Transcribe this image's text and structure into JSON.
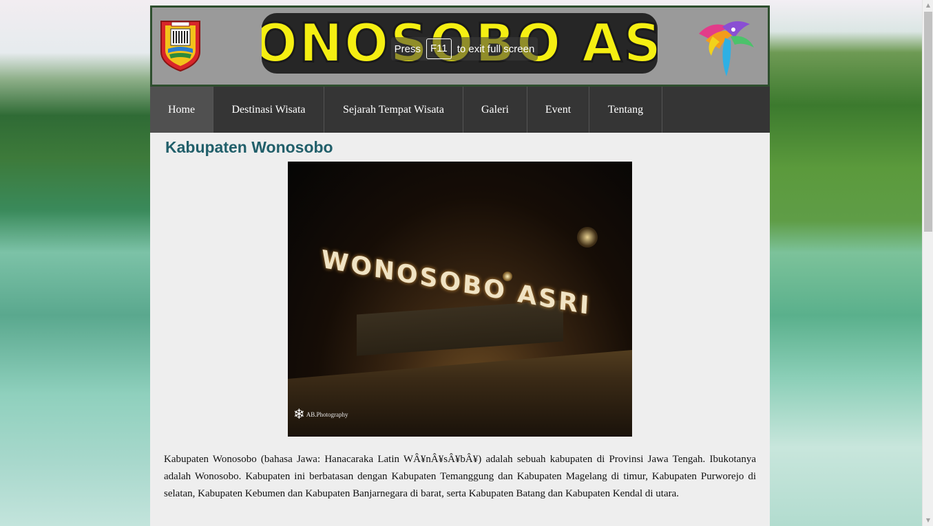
{
  "header": {
    "banner_text": "WONOSOBO ASRI",
    "fullscreen_notice": {
      "prefix": "Press",
      "key": "F11",
      "suffix": "to exit full screen"
    }
  },
  "nav": {
    "items": [
      {
        "label": "Home",
        "active": true
      },
      {
        "label": "Destinasi Wisata",
        "active": false
      },
      {
        "label": "Sejarah Tempat Wisata",
        "active": false
      },
      {
        "label": "Galeri",
        "active": false
      },
      {
        "label": "Event",
        "active": false
      },
      {
        "label": "Tentang",
        "active": false
      }
    ]
  },
  "main": {
    "title": "Kabupaten Wonosobo",
    "photo": {
      "sign_text": "WONOSOBO ASRI",
      "credit": "AB.Photography"
    },
    "paragraph": "Kabupaten Wonosobo (bahasa Jawa: Hanacaraka Latin WÂ¥nÂ¥sÂ¥bÂ¥) adalah sebuah kabupaten di Provinsi Jawa Tengah. Ibukotanya adalah Wonosobo. Kabupaten ini berbatasan dengan Kabupaten Temanggung dan Kabupaten Magelang di timur, Kabupaten Purworejo di selatan, Kabupaten Kebumen dan Kabupaten Banjarnegara di barat, serta Kabupaten Batang dan Kabupaten Kendal di utara."
  },
  "colors": {
    "title": "#215f6a",
    "nav_bg": "#353535",
    "nav_active": "#505050",
    "banner_text": "#f5ef12",
    "header_bg": "#9a9a9a",
    "header_border": "#2e4e2e"
  },
  "icons": {
    "logo_left": "regency-crest-icon",
    "logo_right": "tourism-bird-logo-icon"
  }
}
